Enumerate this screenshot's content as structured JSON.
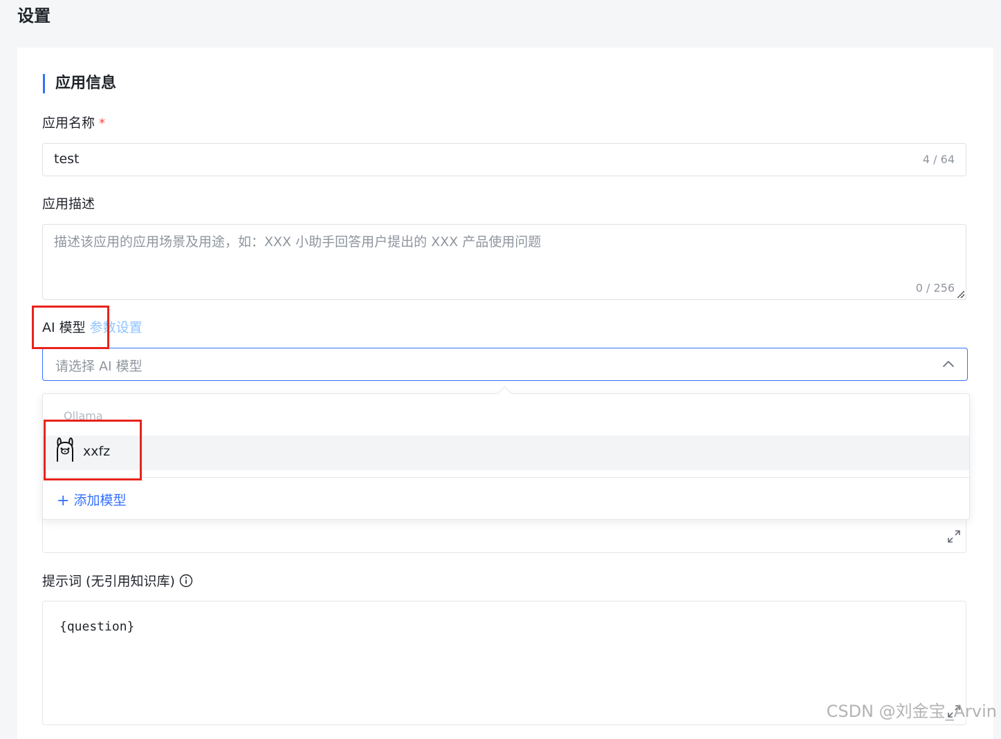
{
  "page": {
    "title": "设置"
  },
  "app_info": {
    "section_title": "应用信息",
    "name_label": "应用名称",
    "required_mark": "*",
    "name_value": "test",
    "name_counter": "4 / 64",
    "desc_label": "应用描述",
    "desc_placeholder": "描述该应用的应用场景及用途，如：XXX 小助手回答用户提出的 XXX 产品使用问题",
    "desc_counter": "0 / 256"
  },
  "ai_model": {
    "label": "AI 模型",
    "param_link": "参数设置",
    "placeholder": "请选择 AI 模型",
    "dropdown": {
      "group_label": "Ollama",
      "options": [
        {
          "label": "xxfz",
          "icon": "llama-icon"
        }
      ],
      "add_label": "添加模型"
    }
  },
  "prompt": {
    "label": "提示词 (无引用知识库)",
    "value": "{question}"
  },
  "watermark": "CSDN @刘金宝_Arvin",
  "colors": {
    "accent": "#3370ff",
    "required": "#f54a45",
    "highlight_box": "#e8221c",
    "link_light": "#8ec3ff"
  }
}
